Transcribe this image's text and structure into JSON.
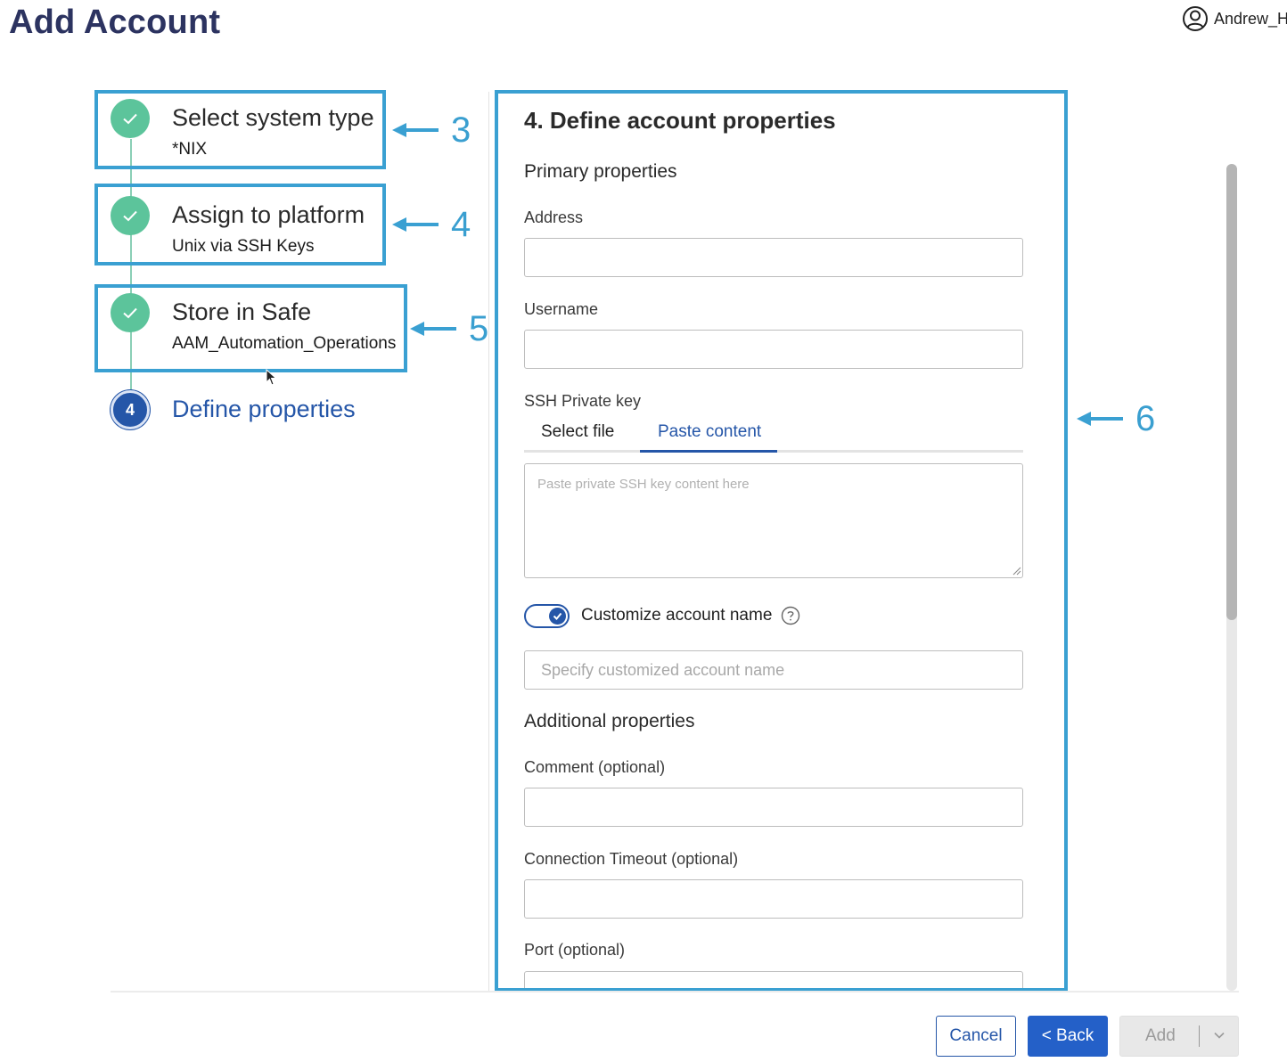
{
  "page": {
    "title": "Add Account"
  },
  "user": {
    "name": "Andrew_H",
    "icon": "user-circle-icon"
  },
  "stepper": {
    "steps": [
      {
        "title": "Select system type",
        "subtitle": "*NIX",
        "status": "complete",
        "callout": "3"
      },
      {
        "title": "Assign to platform",
        "subtitle": "Unix via SSH Keys",
        "status": "complete",
        "callout": "4"
      },
      {
        "title": "Store in Safe",
        "subtitle": "AAM_Automation_Operations",
        "status": "complete",
        "callout": "5"
      },
      {
        "title": "Define properties",
        "number": "4",
        "status": "active"
      }
    ]
  },
  "form": {
    "title": "4. Define account properties",
    "callout": "6",
    "primary_section": "Primary properties",
    "address_label": "Address",
    "username_label": "Username",
    "ssh_key_label": "SSH Private key",
    "tabs": [
      "Select file",
      "Paste content"
    ],
    "active_tab": "Paste content",
    "ssh_key_placeholder": "Paste private SSH key content here",
    "customize_label": "Customize account name",
    "customize_enabled": true,
    "customize_placeholder": "Specify customized account name",
    "additional_section": "Additional properties",
    "comment_label": "Comment (optional)",
    "timeout_label": "Connection Timeout (optional)",
    "port_label": "Port (optional)"
  },
  "footer": {
    "cancel": "Cancel",
    "back": "< Back",
    "add": "Add"
  },
  "colors": {
    "brand": "#2556a8",
    "complete": "#5cc49b",
    "callout": "#3aa0d2",
    "title": "#2c3360"
  }
}
